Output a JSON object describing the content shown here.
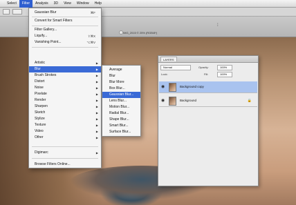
{
  "menubar": {
    "items": [
      "Select",
      "Filter",
      "Analysis",
      "3D",
      "View",
      "Window",
      "Help"
    ],
    "active_index": 1
  },
  "document": {
    "tab_title": "IMG_2015 © 25% (RGB/8*)",
    "accent_color": "#3a6ad6"
  },
  "filter_menu": {
    "items": [
      {
        "label": "Gaussian Blur",
        "shortcut": "⌘F"
      },
      {
        "label": "Convert for Smart Filters",
        "shortcut": ""
      },
      {
        "label": "Filter Gallery...",
        "shortcut": ""
      },
      {
        "label": "Liquify...",
        "shortcut": "⇧⌘X"
      },
      {
        "label": "Vanishing Point...",
        "shortcut": "⌥⌘V"
      },
      {
        "label": "Artistic",
        "submenu": true
      },
      {
        "label": "Blur",
        "submenu": true,
        "highlighted": true
      },
      {
        "label": "Brush Strokes",
        "submenu": true
      },
      {
        "label": "Distort",
        "submenu": true
      },
      {
        "label": "Noise",
        "submenu": true
      },
      {
        "label": "Pixelate",
        "submenu": true
      },
      {
        "label": "Render",
        "submenu": true
      },
      {
        "label": "Sharpen",
        "submenu": true
      },
      {
        "label": "Sketch",
        "submenu": true
      },
      {
        "label": "Stylize",
        "submenu": true
      },
      {
        "label": "Texture",
        "submenu": true
      },
      {
        "label": "Video",
        "submenu": true
      },
      {
        "label": "Other",
        "submenu": true
      },
      {
        "label": "Digimarc",
        "submenu": true
      },
      {
        "label": "Browse Filters Online...",
        "shortcut": ""
      }
    ]
  },
  "blur_submenu": {
    "items": [
      {
        "label": "Average"
      },
      {
        "label": "Blur"
      },
      {
        "label": "Blur More"
      },
      {
        "label": "Box Blur..."
      },
      {
        "label": "Gaussian Blur...",
        "highlighted": true
      },
      {
        "label": "Lens Blur..."
      },
      {
        "label": "Motion Blur..."
      },
      {
        "label": "Radial Blur..."
      },
      {
        "label": "Shape Blur..."
      },
      {
        "label": "Smart Blur..."
      },
      {
        "label": "Surface Blur..."
      }
    ]
  },
  "layers_panel": {
    "tab": "LAYERS",
    "blend_mode": "Normal",
    "opacity_label": "Opacity:",
    "opacity_value": "100%",
    "lock_label": "Lock:",
    "fill_label": "Fill:",
    "fill_value": "100%",
    "layers": [
      {
        "name": "Background copy",
        "selected": true
      },
      {
        "name": "Background",
        "selected": false,
        "locked": true
      }
    ]
  }
}
